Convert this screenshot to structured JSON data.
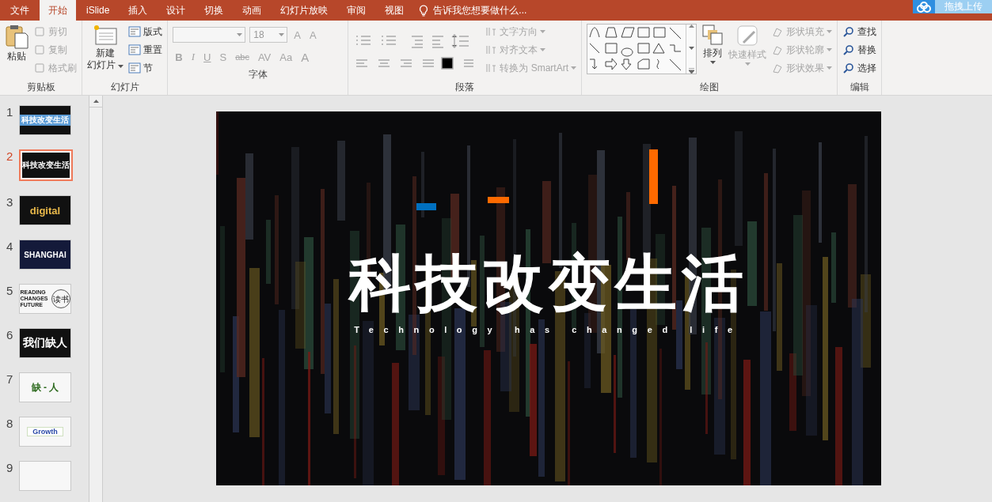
{
  "tabs": [
    {
      "label": "文件",
      "selected": false
    },
    {
      "label": "开始",
      "selected": true
    },
    {
      "label": "iSlide",
      "selected": false
    },
    {
      "label": "插入",
      "selected": false
    },
    {
      "label": "设计",
      "selected": false
    },
    {
      "label": "切换",
      "selected": false
    },
    {
      "label": "动画",
      "selected": false
    },
    {
      "label": "幻灯片放映",
      "selected": false
    },
    {
      "label": "审阅",
      "selected": false
    },
    {
      "label": "视图",
      "selected": false
    }
  ],
  "tell_me": {
    "placeholder": "告诉我您想要做什么..."
  },
  "upload_button": {
    "label": "拖拽上传"
  },
  "ribbon": {
    "clipboard": {
      "title": "剪贴板",
      "paste": "粘贴",
      "items": [
        {
          "label": "剪切",
          "disabled": true
        },
        {
          "label": "复制",
          "disabled": true
        },
        {
          "label": "格式刷",
          "disabled": true
        }
      ]
    },
    "slides": {
      "title": "幻灯片",
      "new_slide": [
        "新建",
        "幻灯片"
      ],
      "items": [
        {
          "label": "版式",
          "disabled": false
        },
        {
          "label": "重置",
          "disabled": false
        },
        {
          "label": "节",
          "disabled": false
        }
      ]
    },
    "font": {
      "title": "字体",
      "font_size": "18",
      "size_buttons": [
        {
          "label": "A",
          "disabled": true
        },
        {
          "label": "A",
          "disabled": true
        }
      ],
      "buttons": [
        {
          "label": "B",
          "disabled": true
        },
        {
          "label": "I",
          "disabled": true
        },
        {
          "label": "U",
          "disabled": true
        },
        {
          "label": "S",
          "disabled": true
        },
        {
          "label": "abc",
          "disabled": true
        },
        {
          "label": "AV",
          "disabled": true
        },
        {
          "label": "Aa",
          "disabled": true
        },
        {
          "label": "A",
          "disabled": true
        }
      ]
    },
    "paragraph": {
      "title": "段落",
      "items": [
        {
          "label": "文字方向",
          "disabled": true
        },
        {
          "label": "对齐文本",
          "disabled": true
        },
        {
          "label": "转换为 SmartArt",
          "disabled": true
        }
      ]
    },
    "drawing": {
      "title": "绘图",
      "arrange": "排列",
      "quick_styles": {
        "label": "快速样式",
        "disabled": true
      },
      "items": [
        {
          "label": "形状填充",
          "disabled": true
        },
        {
          "label": "形状轮廓",
          "disabled": true
        },
        {
          "label": "形状效果",
          "disabled": true
        }
      ]
    },
    "editing": {
      "title": "编辑",
      "items": [
        {
          "label": "查找",
          "disabled": false
        },
        {
          "label": "替换",
          "disabled": false
        },
        {
          "label": "选择",
          "disabled": false
        }
      ]
    }
  },
  "slides": [
    {
      "number": "1",
      "selected": false,
      "kind": "banner",
      "texts": [
        "科技改变生活"
      ]
    },
    {
      "number": "2",
      "selected": true,
      "kind": "dark",
      "texts": [
        "科技改变生活"
      ]
    },
    {
      "number": "3",
      "selected": false,
      "kind": "digital",
      "texts": [
        "digital"
      ]
    },
    {
      "number": "4",
      "selected": false,
      "kind": "city",
      "texts": [
        "SHANGHAI"
      ]
    },
    {
      "number": "5",
      "selected": false,
      "kind": "reading",
      "texts": [
        "READING",
        "CHANGES",
        "FUTURE",
        "读书"
      ]
    },
    {
      "number": "6",
      "selected": false,
      "kind": "big",
      "texts": [
        "我们缺人"
      ]
    },
    {
      "number": "7",
      "selected": false,
      "kind": "light",
      "texts": [
        "缺 - 人"
      ]
    },
    {
      "number": "8",
      "selected": false,
      "kind": "growth",
      "texts": [
        "Growth"
      ]
    },
    {
      "number": "9",
      "selected": false,
      "kind": "blank"
    }
  ],
  "slide": {
    "title": "科技改变生活",
    "subtitle": "Technology has changed life"
  }
}
